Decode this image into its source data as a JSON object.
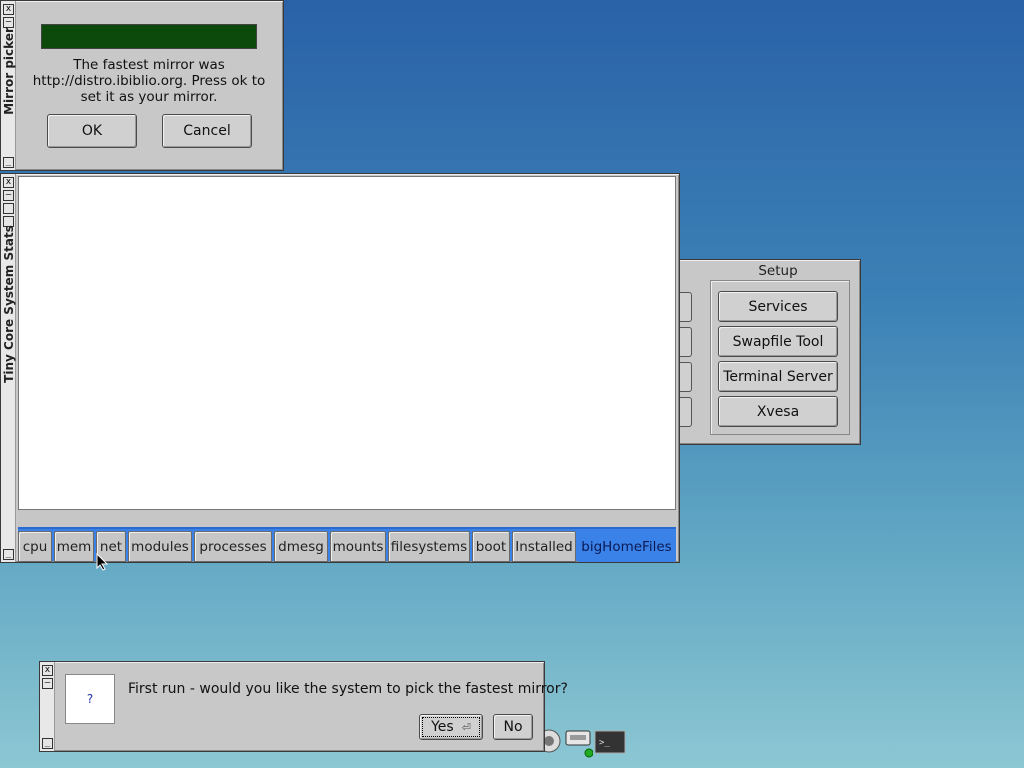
{
  "mirror_picker": {
    "title": "Mirror picker",
    "progress": 1.0,
    "message": "The fastest mirror was http://distro.ibiblio.org. Press ok to set it as your mirror.",
    "ok_label": "OK",
    "cancel_label": "Cancel",
    "buttons": {
      "close": "x",
      "minimize": "–",
      "bottom": "_"
    }
  },
  "stats_window": {
    "title": "Tiny Core System Stats",
    "tabs": [
      "cpu",
      "mem",
      "net",
      "modules",
      "processes",
      "dmesg",
      "mounts",
      "filesystems",
      "boot",
      "Installed",
      "bigHomeFiles"
    ],
    "active_tab": "bigHomeFiles"
  },
  "setup_panel": {
    "title": "Setup",
    "buttons": [
      "Services",
      "Swapfile Tool",
      "Terminal Server",
      "Xvesa"
    ]
  },
  "firstrun_dialog": {
    "icon_text": "?",
    "message": "First run - would you like the system to pick the fastest mirror?",
    "yes_label": "Yes",
    "no_label": "No"
  },
  "dock": {
    "icons": [
      "apps-icon",
      "mount-icon",
      "terminal-icon"
    ]
  },
  "colors": {
    "progress_fill": "#0b4a0b",
    "active_tab": "#3b82e8",
    "desktop_top": "#2a62a8",
    "desktop_bottom": "#8cc7d3"
  }
}
